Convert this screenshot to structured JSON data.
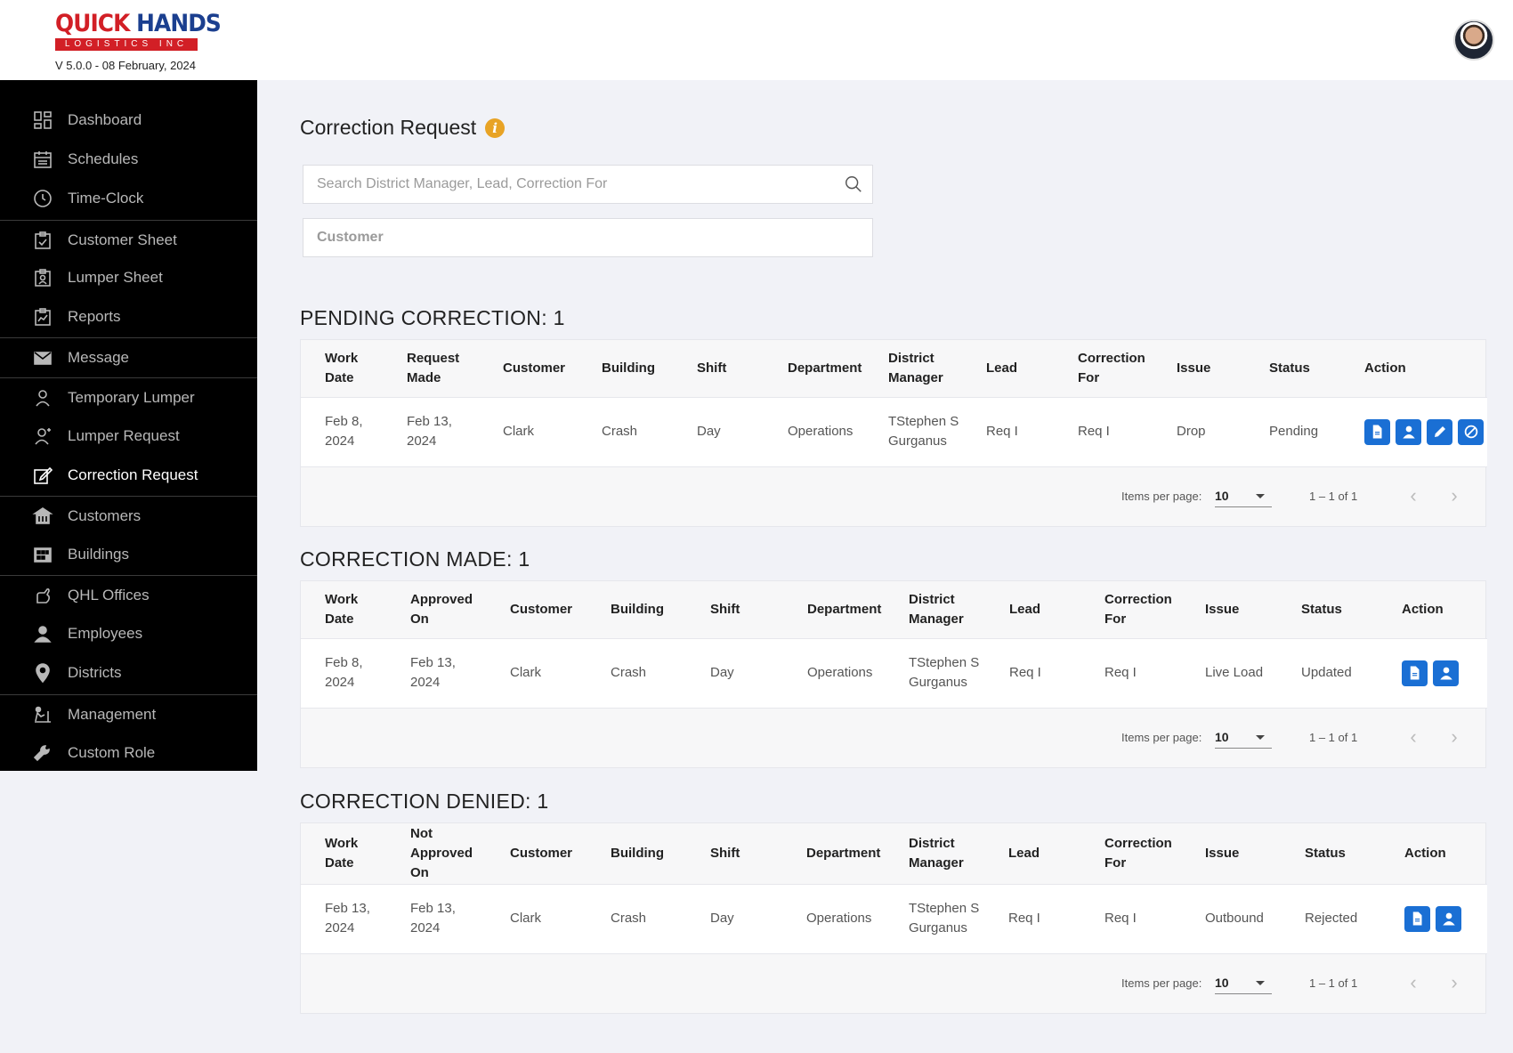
{
  "header": {
    "logo_line1": "QUICK",
    "logo_line1b": "HANDS",
    "logo_sub": "LOGISTICS INC",
    "version": "V 5.0.0 - 08 February, 2024"
  },
  "sidebar": {
    "items": [
      {
        "label": "Dashboard",
        "icon": "dashboard-icon"
      },
      {
        "label": "Schedules",
        "icon": "calendar-icon"
      },
      {
        "label": "Time-Clock",
        "icon": "clock-icon"
      },
      {
        "label": "Customer Sheet",
        "icon": "clipboard-check-icon"
      },
      {
        "label": "Lumper Sheet",
        "icon": "clipboard-person-icon"
      },
      {
        "label": "Reports",
        "icon": "report-chart-icon"
      },
      {
        "label": "Message",
        "icon": "envelope-icon"
      },
      {
        "label": "Temporary Lumper",
        "icon": "person-icon"
      },
      {
        "label": "Lumper Request",
        "icon": "person-plus-icon"
      },
      {
        "label": "Correction Request",
        "icon": "edit-icon"
      },
      {
        "label": "Customers",
        "icon": "bank-icon"
      },
      {
        "label": "Buildings",
        "icon": "building-icon"
      },
      {
        "label": "QHL Offices",
        "icon": "hand-icon"
      },
      {
        "label": "Employees",
        "icon": "user-icon"
      },
      {
        "label": "Districts",
        "icon": "location-pin-icon"
      },
      {
        "label": "Management",
        "icon": "management-icon"
      },
      {
        "label": "Custom Role",
        "icon": "wrench-icon"
      }
    ]
  },
  "main": {
    "title": "Correction Request",
    "search_placeholder": "Search District Manager, Lead, Correction For",
    "customer_label": "Customer"
  },
  "pending": {
    "title": "PENDING CORRECTION: 1",
    "headers": [
      "Work Date",
      "Request Made",
      "Customer",
      "Building",
      "Shift",
      "Department",
      "District Manager",
      "Lead",
      "Correction For",
      "Issue",
      "Status",
      "Action"
    ],
    "rows": [
      {
        "work_date": "Feb 8, 2024",
        "request": "Feb 13, 2024",
        "customer": "Clark",
        "building": "Crash",
        "shift": "Day",
        "department": "Operations",
        "district_manager": "TStephen S Gurganus",
        "lead": "Req I",
        "correction_for": "Req I",
        "issue": "Drop",
        "status": "Pending"
      }
    ]
  },
  "made": {
    "title": "CORRECTION MADE: 1",
    "headers": [
      "Work Date",
      "Approved On",
      "Customer",
      "Building",
      "Shift",
      "Department",
      "District Manager",
      "Lead",
      "Correction For",
      "Issue",
      "Status",
      "Action"
    ],
    "rows": [
      {
        "work_date": "Feb 8, 2024",
        "request": "Feb 13, 2024",
        "customer": "Clark",
        "building": "Crash",
        "shift": "Day",
        "department": "Operations",
        "district_manager": "TStephen S Gurganus",
        "lead": "Req I",
        "correction_for": "Req I",
        "issue": "Live Load",
        "status": "Updated"
      }
    ]
  },
  "denied": {
    "title": "CORRECTION DENIED: 1",
    "headers": [
      "Work Date",
      "Not Approved On",
      "Customer",
      "Building",
      "Shift",
      "Department",
      "District Manager",
      "Lead",
      "Correction For",
      "Issue",
      "Status",
      "Action"
    ],
    "rows": [
      {
        "work_date": "Feb 13, 2024",
        "request": "Feb 13, 2024",
        "customer": "Clark",
        "building": "Crash",
        "shift": "Day",
        "department": "Operations",
        "district_manager": "TStephen S Gurganus",
        "lead": "Req I",
        "correction_for": "Req I",
        "issue": "Outbound",
        "status": "Rejected"
      }
    ]
  },
  "pager": {
    "items_per_page_label": "Items per page:",
    "items_per_page_value": "10",
    "range": "1 – 1 of 1"
  },
  "colors": {
    "sidebar_bg": "#000000",
    "action_button": "#1a6fd4",
    "info_icon": "#e8a325",
    "brand_red": "#d21f26",
    "brand_blue": "#1b3f8f"
  }
}
